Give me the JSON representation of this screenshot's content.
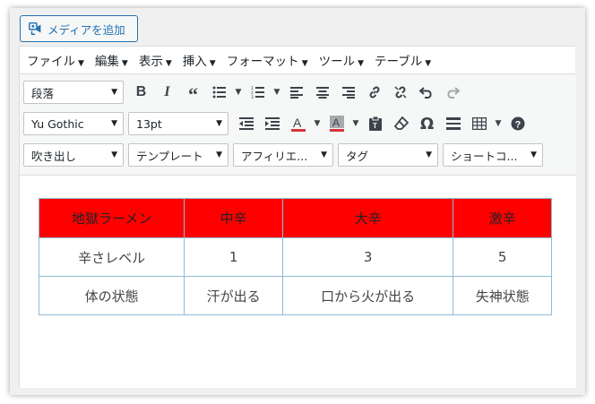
{
  "media_button": {
    "label": "メディアを追加"
  },
  "menubar": {
    "items": [
      "ファイル",
      "編集",
      "表示",
      "挿入",
      "フォーマット",
      "ツール",
      "テーブル"
    ]
  },
  "toolbar": {
    "row1": {
      "block_format": "段落",
      "buttons": [
        "bold-icon",
        "italic-icon",
        "blockquote-icon",
        "bullet-list-icon",
        "numbered-list-icon",
        "align-left-icon",
        "align-center-icon",
        "align-right-icon",
        "link-icon",
        "unlink-icon",
        "undo-icon",
        "redo-icon"
      ]
    },
    "row2": {
      "font_family": "Yu Gothic",
      "font_size": "13pt",
      "buttons": [
        "outdent-icon",
        "indent-icon",
        "text-color-icon",
        "background-color-icon",
        "paste-text-icon",
        "clear-format-icon",
        "special-char-icon",
        "horizontal-line-icon",
        "table-icon",
        "help-icon"
      ],
      "text_color": "#d63638",
      "bg_color": "#d63638"
    },
    "row3": {
      "dropdowns": [
        "吹き出し",
        "テンプレート",
        "アフィリエ...",
        "タグ",
        "ショートコ..."
      ]
    }
  },
  "table": {
    "header_color": "#ff0000",
    "headers": [
      "地獄ラーメン",
      "中辛",
      "大辛",
      "激辛"
    ],
    "rows": [
      [
        "辛さレベル",
        "1",
        "3",
        "5"
      ],
      [
        "体の状態",
        "汗が出る",
        "口から火が出る",
        "失神状態"
      ]
    ]
  }
}
